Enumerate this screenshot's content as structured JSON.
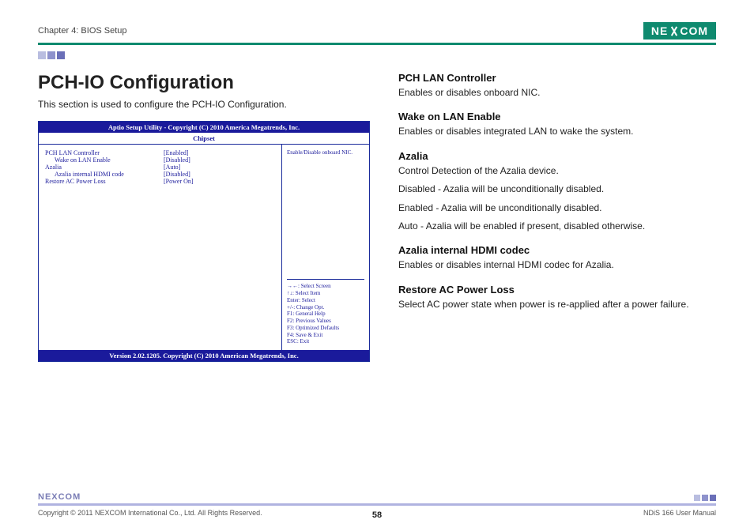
{
  "header": {
    "chapter": "Chapter 4: BIOS Setup",
    "brand": "NEXCOM"
  },
  "main": {
    "title": "PCH-IO Configuration",
    "intro": "This section is used to configure the PCH-IO Configuration."
  },
  "bios": {
    "title": "Aptio Setup Utility - Copyright (C) 2010 America Megatrends, Inc.",
    "tab": "Chipset",
    "rows": [
      {
        "label": "PCH LAN Controller",
        "value": "[Enabled]",
        "indent": false
      },
      {
        "label": "Wake on LAN Enable",
        "value": "[Disabled]",
        "indent": true
      },
      {
        "label": "Azalia",
        "value": "[Auto]",
        "indent": false
      },
      {
        "label": "Azalia internal HDMI code",
        "value": "[Disabled]",
        "indent": true
      },
      {
        "label": "",
        "value": "",
        "indent": false
      },
      {
        "label": "Restore AC Power Loss",
        "value": "[Power On]",
        "indent": false
      }
    ],
    "help_text": "Enable/Disable onboard NIC.",
    "help_keys": [
      "→←: Select Screen",
      "↑↓: Select Item",
      "Enter: Select",
      "+/-: Change Opt.",
      "F1: General Help",
      "F2: Previous Values",
      "F3: Optimized Defaults",
      "F4: Save & Exit",
      "ESC: Exit"
    ],
    "footer": "Version 2.02.1205. Copyright (C) 2010 American Megatrends, Inc."
  },
  "sections": [
    {
      "heading": "PCH LAN Controller",
      "paragraphs": [
        "Enables or disables onboard NIC."
      ]
    },
    {
      "heading": "Wake on LAN Enable",
      "paragraphs": [
        "Enables or disables integrated LAN to wake the system."
      ]
    },
    {
      "heading": "Azalia",
      "paragraphs": [
        "Control Detection of the Azalia device.",
        "Disabled - Azalia will be unconditionally disabled.",
        "Enabled - Azalia will be unconditionally disabled.",
        "Auto - Azalia will be enabled if present, disabled otherwise."
      ]
    },
    {
      "heading": "Azalia internal HDMI codec",
      "paragraphs": [
        "Enables or disables internal HDMI codec for Azalia."
      ]
    },
    {
      "heading": "Restore AC Power Loss",
      "paragraphs": [
        "Select AC power state when power is re-applied after a power failure."
      ]
    }
  ],
  "footer": {
    "copyright": "Copyright © 2011 NEXCOM International Co., Ltd. All Rights Reserved.",
    "page": "58",
    "manual": "NDiS 166 User Manual",
    "brand": "NEXCOM"
  }
}
